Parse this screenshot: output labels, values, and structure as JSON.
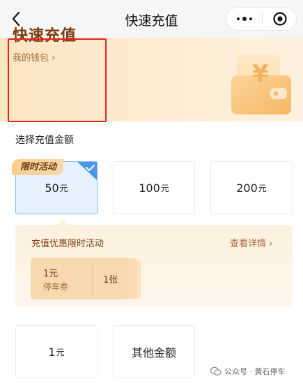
{
  "navbar": {
    "title": "快速充值",
    "back_icon": "chevron-left-icon",
    "more_icon": "more-dots-icon",
    "close_icon": "circle-close-icon"
  },
  "banner": {
    "title": "快速充值",
    "wallet_link": "我的钱包",
    "wallet_chevron": "›",
    "wallet_symbol": "¥",
    "colors": {
      "title": "#7a3d10",
      "gradient_start": "#fce5c1",
      "gradient_end": "#fdf1df"
    }
  },
  "section": {
    "label": "选择充值金额"
  },
  "amounts": [
    {
      "value": "50",
      "unit": "元",
      "selected": true,
      "tag": "限时活动"
    },
    {
      "value": "100",
      "unit": "元",
      "selected": false
    },
    {
      "value": "200",
      "unit": "元",
      "selected": false
    },
    {
      "value": "1",
      "unit": "元",
      "selected": false
    }
  ],
  "other_amount": {
    "label": "其他金额"
  },
  "promo": {
    "title": "充值优惠限时活动",
    "detail_link": "查看详情",
    "detail_chevron": "›",
    "coupon": {
      "value": "1元",
      "name": "停车券",
      "quantity": "1张"
    }
  },
  "watermark": {
    "text": "公众号 · 黄石停车"
  },
  "colors": {
    "selected_bg": "#e6f3ff",
    "selected_border": "#7cb9ef",
    "check_blue": "#4f95e8",
    "tag_gold": "#f9cf8f",
    "highlight_red": "#e8231d"
  }
}
